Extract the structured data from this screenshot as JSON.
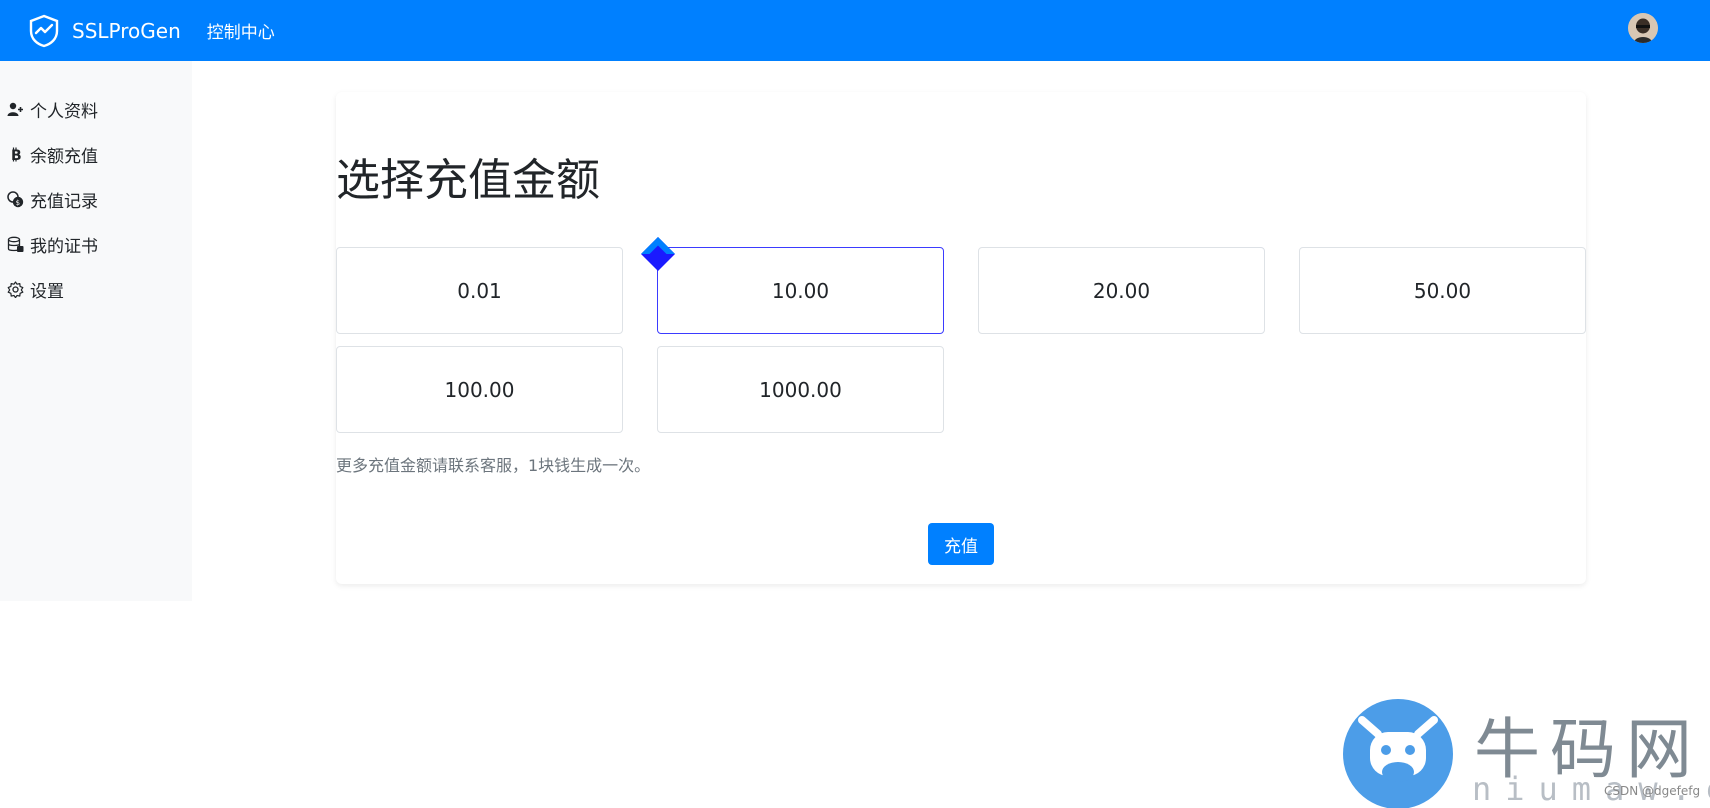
{
  "navbar": {
    "brand": "SSLProGen",
    "link": "控制中心",
    "bg_color": "#0080ff",
    "brand_icon": "shield-pulse-icon",
    "avatar_icon": "user-avatar"
  },
  "sidebar": {
    "items": [
      {
        "icon": "user-plus-icon",
        "label": "个人资料"
      },
      {
        "icon": "bitcoin-icon",
        "label": "余额充值"
      },
      {
        "icon": "coins-icon",
        "label": "充值记录"
      },
      {
        "icon": "database-lock-icon",
        "label": "我的证书"
      },
      {
        "icon": "gear-icon",
        "label": "设置"
      }
    ]
  },
  "main": {
    "title": "选择充值金额",
    "amounts": [
      "0.01",
      "10.00",
      "20.00",
      "50.00",
      "100.00",
      "1000.00"
    ],
    "selected": "10.00",
    "hint": "更多充值金额请联系客服，1块钱生成一次。",
    "submit_label": "充值",
    "accent_color": "#3b3bff"
  },
  "watermark": {
    "text": "牛码网",
    "sub": "niumaw.cn",
    "credit": "CSDN @dgefefg"
  }
}
